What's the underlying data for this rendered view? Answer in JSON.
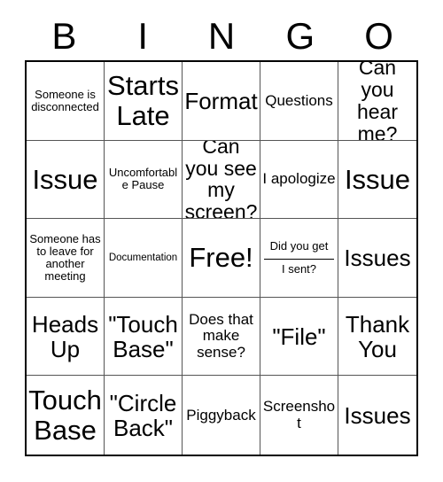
{
  "card": {
    "title_letters": [
      "B",
      "I",
      "N",
      "G",
      "O"
    ],
    "rows": 5,
    "columns": 5,
    "colors": {
      "background": "#ffffff",
      "text": "#000000",
      "outer_border": "#000000",
      "inner_border": "#555555"
    },
    "cells": [
      [
        {
          "text": "Someone is disconnected",
          "size": "sm",
          "type": "text"
        },
        {
          "text": "Starts Late",
          "size": "xxl",
          "type": "text"
        },
        {
          "text": "Format",
          "size": "xl",
          "type": "text"
        },
        {
          "text": "Questions",
          "size": "md",
          "type": "text"
        },
        {
          "text": "Can you hear me?",
          "size": "lg",
          "type": "text"
        }
      ],
      [
        {
          "text": "Issue",
          "size": "xxl",
          "type": "text"
        },
        {
          "text": "Uncomfortable Pause",
          "size": "sm",
          "type": "text"
        },
        {
          "text": "Can you see my screen?",
          "size": "lg",
          "type": "text"
        },
        {
          "text": "I apologize",
          "size": "md",
          "type": "text"
        },
        {
          "text": "Issue",
          "size": "xxl",
          "type": "text"
        }
      ],
      [
        {
          "text": "Someone has to leave for another meeting",
          "size": "sm",
          "type": "text"
        },
        {
          "text": "Documentation",
          "size": "xs",
          "type": "text"
        },
        {
          "text": "Free!",
          "size": "xxl",
          "type": "free"
        },
        {
          "text": "Did you get I sent?",
          "size": "sm",
          "type": "fill-blank",
          "top_text": "Did you get",
          "bottom_text": "I sent?"
        },
        {
          "text": "Issues",
          "size": "xl",
          "type": "text"
        }
      ],
      [
        {
          "text": "Heads Up",
          "size": "xl",
          "type": "text"
        },
        {
          "text": "\"Touch Base\"",
          "size": "xl",
          "type": "text"
        },
        {
          "text": "Does that make sense?",
          "size": "md",
          "type": "text"
        },
        {
          "text": "\"File\"",
          "size": "xl",
          "type": "text"
        },
        {
          "text": "Thank You",
          "size": "xl",
          "type": "text"
        }
      ],
      [
        {
          "text": "Touch Base",
          "size": "xxl",
          "type": "text"
        },
        {
          "text": "\"Circle Back\"",
          "size": "xl",
          "type": "text"
        },
        {
          "text": "Piggyback",
          "size": "md",
          "type": "text"
        },
        {
          "text": "Screenshot",
          "size": "md",
          "type": "text"
        },
        {
          "text": "Issues",
          "size": "xl",
          "type": "text"
        }
      ]
    ]
  }
}
